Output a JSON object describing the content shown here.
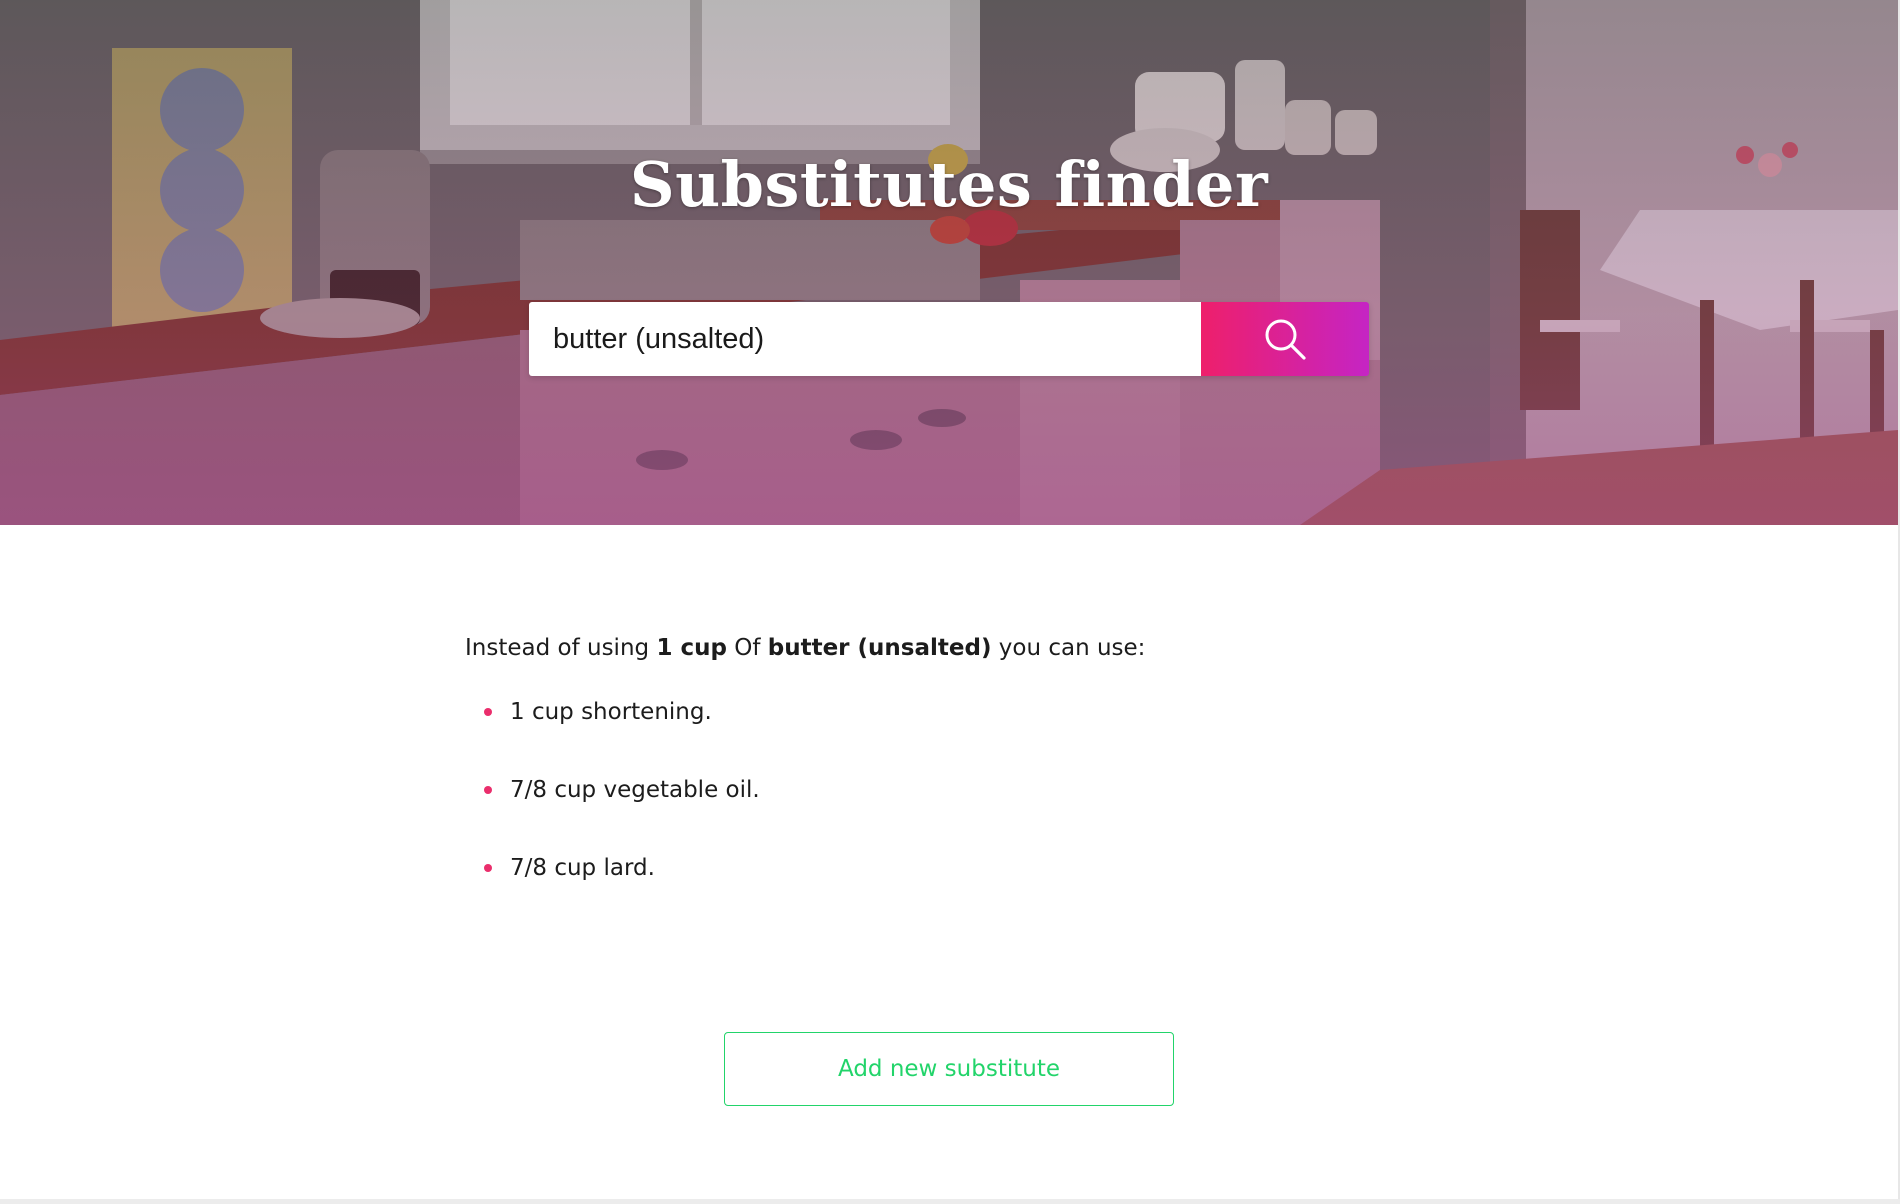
{
  "header": {
    "title": "Substitutes finder"
  },
  "search": {
    "value": "butter (unsalted)",
    "button_icon": "search-icon"
  },
  "result": {
    "prefix": "Instead of using",
    "quantity": "1 cup",
    "of_word": "Of",
    "ingredient": "butter (unsalted)",
    "suffix": "you can use:",
    "substitutes": [
      "1 cup shortening.",
      "7/8 cup vegetable oil.",
      "7/8 cup lard."
    ]
  },
  "actions": {
    "add_label": "Add new substitute"
  },
  "colors": {
    "accent_pink": "#ee1f6b",
    "accent_purple": "#c524c4",
    "bullet": "#ea2e6c",
    "add_button": "#22d46a"
  }
}
